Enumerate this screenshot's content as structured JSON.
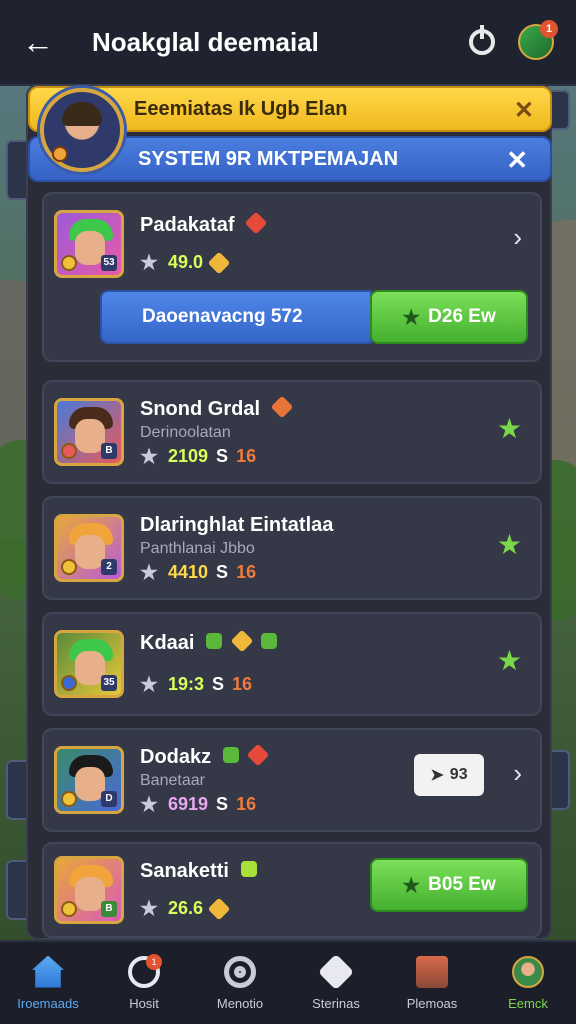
{
  "header": {
    "back_icon": "arrow-left-icon",
    "title": "Noakglal deemaial",
    "power_icon": "power-icon",
    "avatar_badge": "1"
  },
  "banners": {
    "primary": "Eeemiatas Ik Ugb Elan",
    "secondary": "SYSTEM 9R MKTPEMAJAN"
  },
  "cards": [
    {
      "name": "Padakataf",
      "value": "49.0",
      "progress_label": "Daoenavacng 572",
      "button_label": "D26 Ew"
    },
    {
      "name": "Snond Grdal",
      "subtitle": "Derinoolatan",
      "value": "2109",
      "mid": "S",
      "count": "16"
    },
    {
      "name": "Dlaringhlat Eintatlaa",
      "subtitle": "Panthlanai Jbbo",
      "value": "4410",
      "mid": "S",
      "count": "16"
    },
    {
      "name": "Kdaai",
      "value": "19:3",
      "mid": "S",
      "count": "16"
    },
    {
      "name": "Dodakz",
      "subtitle": "Banetaar",
      "value": "6919",
      "mid": "S",
      "count": "16",
      "chip_label": "93"
    },
    {
      "name": "Sanaketti",
      "value": "26.6",
      "button_label": "B05 Ew"
    }
  ],
  "nav": [
    {
      "label": "Iroemaads",
      "icon": "home-icon"
    },
    {
      "label": "Hosit",
      "icon": "target-icon",
      "badge": "1"
    },
    {
      "label": "Menotio",
      "icon": "ring-icon"
    },
    {
      "label": "Sterinas",
      "icon": "heart-icon"
    },
    {
      "label": "Plemoas",
      "icon": "shop-icon"
    },
    {
      "label": "Eemck",
      "icon": "profile-icon"
    }
  ],
  "colors": {
    "accent_green": "#7ce05a",
    "accent_blue": "#4b7ee0",
    "accent_gold": "#ffd84a",
    "value_green": "#d8ff5a",
    "count_orange": "#f07a3a"
  }
}
